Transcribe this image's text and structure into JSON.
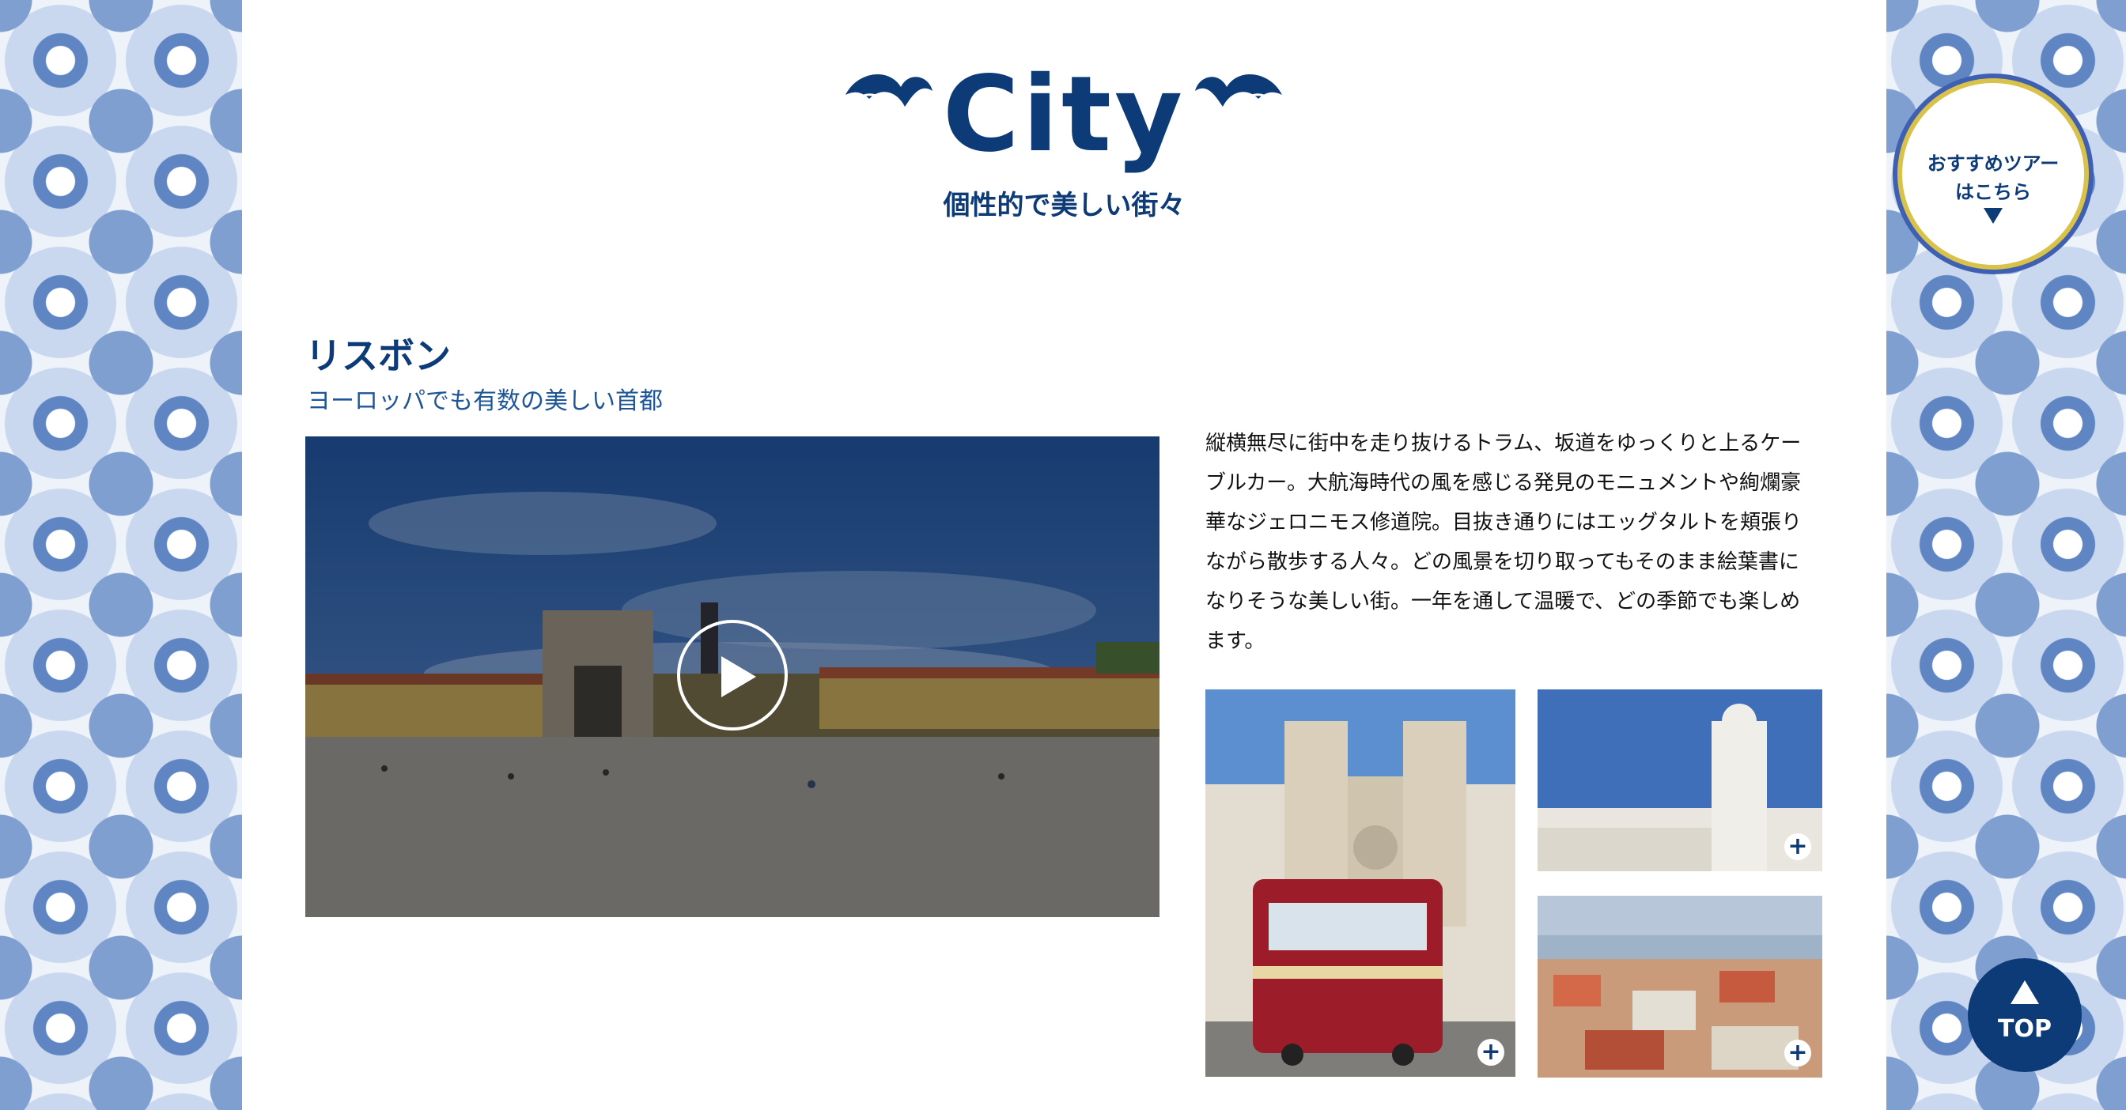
{
  "header": {
    "title": "City",
    "subtitle": "個性的で美しい街々"
  },
  "section": {
    "title": "リスボン",
    "subtitle": "ヨーロッパでも有数の美しい首都",
    "description": "縦横無尽に街中を走り抜けるトラム、坂道をゆっくりと上るケーブルカー。大航海時代の風を感じる発見のモニュメントや絢爛豪華なジェロニモス修道院。目抜き通りにはエッグタルトを頬張りながら散歩する人々。どの風景を切り取ってもそのまま絵葉書になりそうな美しい街。一年を通して温暖で、どの季節でも楽しめます。"
  },
  "tour_badge": {
    "line1": "おすすめツアー",
    "line2": "はこちら"
  },
  "top_button": {
    "label": "TOP"
  },
  "colors": {
    "brand_navy": "#0d3b78",
    "tile_blue": "#5f86c2",
    "badge_gold": "#d9c24a"
  },
  "icons": {
    "play": "play-icon",
    "expand": "plus-icon",
    "badge_arrow": "chevron-down-icon",
    "top_arrow": "arrow-up-icon"
  }
}
